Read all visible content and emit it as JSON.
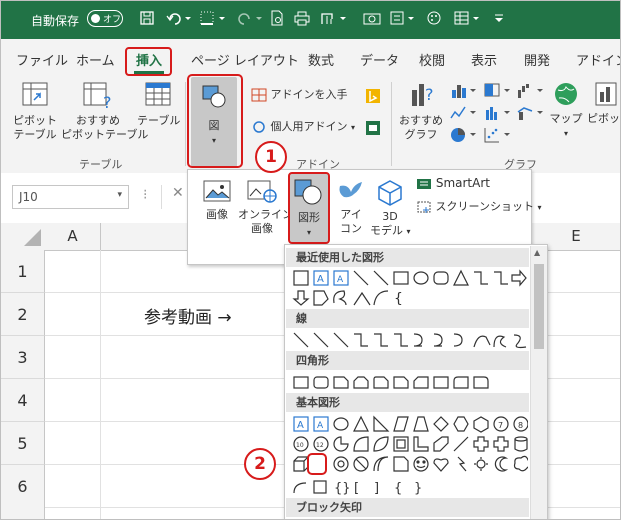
{
  "titlebar": {
    "autosave_label": "自動保存",
    "autosave_state": "オフ",
    "qat_icons": [
      "save-icon",
      "undo-icon",
      "border-icon",
      "redo-icon",
      "print-preview-icon",
      "quick-print-icon",
      "sort-icon",
      "camera-icon",
      "format-icon",
      "highlight-icon",
      "form-icon",
      "customize-icon"
    ]
  },
  "tabs": [
    {
      "label": "ファイル"
    },
    {
      "label": "ホーム"
    },
    {
      "label": "挿入",
      "active": true
    },
    {
      "label": "ページ レイアウト"
    },
    {
      "label": "数式"
    },
    {
      "label": "データ"
    },
    {
      "label": "校閲"
    },
    {
      "label": "表示"
    },
    {
      "label": "開発"
    },
    {
      "label": "アドイン"
    }
  ],
  "ribbon": {
    "pivot_label1": "ピボット",
    "pivot_label2": "テーブル",
    "rec_pivot_label1": "おすすめ",
    "rec_pivot_label2": "ピボットテーブル",
    "table_label": "テーブル",
    "table_group": "テーブル",
    "figure_label": "図",
    "addin_get": "アドインを入手",
    "addin_personal": "個人用アドイン",
    "addin_group": "アドイン",
    "rec_chart_label1": "おすすめ",
    "rec_chart_label2": "グラフ",
    "map_label": "マップ",
    "pivotchart_label": "ピボット",
    "chart_group": "グラフ"
  },
  "namebox": {
    "value": "J10"
  },
  "columns": [
    "A",
    "E"
  ],
  "rows": [
    "1",
    "2",
    "3",
    "4",
    "5",
    "6"
  ],
  "cell_text": "参考動画 →",
  "callouts": {
    "one": "1",
    "two": "2"
  },
  "insert_menu": {
    "picture": "画像",
    "online1": "オンライン",
    "online2": "画像",
    "shapes": "図形",
    "icons1": "アイ",
    "icons2": "コン",
    "model1": "3D",
    "model2": "モデル",
    "smartart": "SmartArt",
    "screenshot": "スクリーンショット"
  },
  "shapes_gallery": {
    "recent": "最近使用した図形",
    "lines": "線",
    "rectangles": "四角形",
    "basic": "基本図形",
    "block_arrows": "ブロック矢印"
  },
  "colors": {
    "excel_green": "#217346",
    "highlight_red": "#d71b1b"
  }
}
